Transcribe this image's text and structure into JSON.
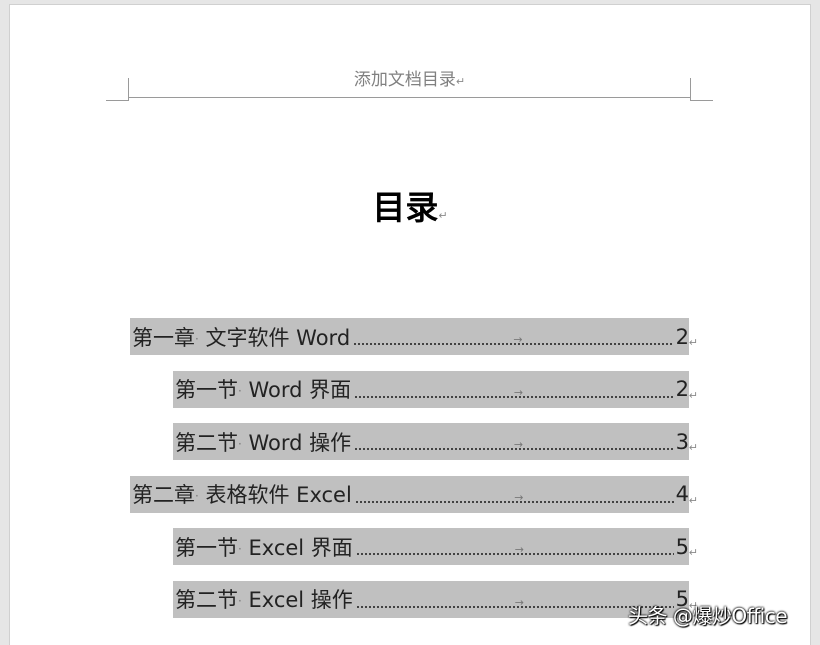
{
  "header": {
    "text": "添加文档目录",
    "para_mark": "↵"
  },
  "title": {
    "text": "目录",
    "para_mark": "↵"
  },
  "toc": [
    {
      "level": 1,
      "prefix": "第一章",
      "text": "文字软件 Word",
      "page": "2"
    },
    {
      "level": 2,
      "prefix": "第一节",
      "text": "Word 界面",
      "page": "2"
    },
    {
      "level": 2,
      "prefix": "第二节",
      "text": "Word 操作",
      "page": "3"
    },
    {
      "level": 1,
      "prefix": "第二章",
      "text": "表格软件 Excel",
      "page": "4"
    },
    {
      "level": 2,
      "prefix": "第一节",
      "text": "Excel 界面",
      "page": "5"
    },
    {
      "level": 2,
      "prefix": "第二节",
      "text": "Excel 操作",
      "page": "5"
    }
  ],
  "marks": {
    "space": "·",
    "tab": "→",
    "para": "↵"
  },
  "watermark": {
    "text": "头条 @爆炒Office"
  }
}
